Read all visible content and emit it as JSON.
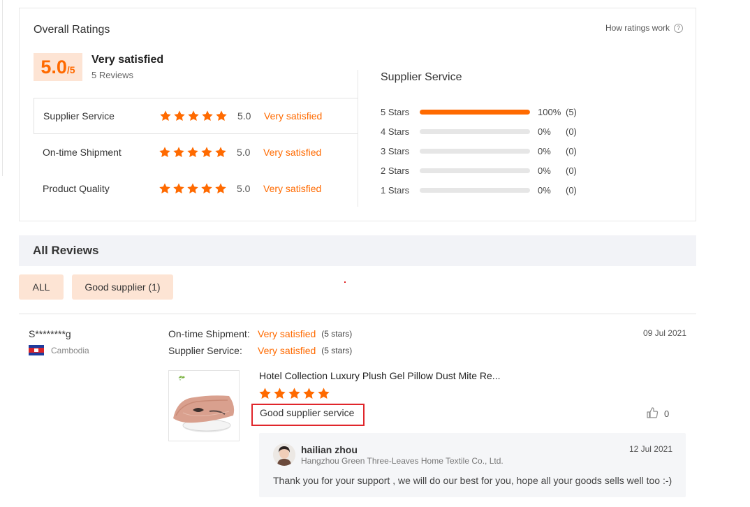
{
  "colors": {
    "accent": "#ff6a00",
    "accent_bg": "#fde4d4",
    "highlight_border": "#e0262b"
  },
  "overall": {
    "title": "Overall Ratings",
    "how_ratings_work": "How ratings work",
    "help_icon": "?",
    "score": "5.0",
    "score_max": "/5",
    "score_label": "Very satisfied",
    "reviews_count": "5 Reviews",
    "dimensions": [
      {
        "name": "Supplier Service",
        "stars": 5,
        "score": "5.0",
        "desc": "Very satisfied"
      },
      {
        "name": "On-time Shipment",
        "stars": 5,
        "score": "5.0",
        "desc": "Very satisfied"
      },
      {
        "name": "Product Quality",
        "stars": 5,
        "score": "5.0",
        "desc": "Very satisfied"
      }
    ]
  },
  "supplier_service": {
    "title": "Supplier Service",
    "distribution": [
      {
        "label": "5  Stars",
        "fraction": 1.0,
        "pct": "100%",
        "count": "(5)"
      },
      {
        "label": "4  Stars",
        "fraction": 0,
        "pct": "0%",
        "count": "(0)"
      },
      {
        "label": "3  Stars",
        "fraction": 0,
        "pct": "0%",
        "count": "(0)"
      },
      {
        "label": "2  Stars",
        "fraction": 0,
        "pct": "0%",
        "count": "(0)"
      },
      {
        "label": "1  Stars",
        "fraction": 0,
        "pct": "0%",
        "count": "(0)"
      }
    ]
  },
  "all_reviews": {
    "title": "All Reviews",
    "filters": {
      "all": "ALL",
      "good_supplier": "Good supplier (1)"
    }
  },
  "review": {
    "reviewer": "S********g",
    "country": "Cambodia",
    "flag_icon": "cambodia-flag-icon",
    "shipment_label": "On-time Shipment:",
    "shipment_value": "Very satisfied",
    "shipment_stars": "(5 stars)",
    "service_label": "Supplier Service:",
    "service_value": "Very satisfied",
    "service_stars": "(5 stars)",
    "date": "09 Jul 2021",
    "product_title": "Hotel Collection Luxury Plush Gel Pillow Dust Mite Re...",
    "product_image_icon": "pillow-product-image",
    "stars": 5,
    "text": "Good supplier service",
    "likes": "0",
    "like_icon": "thumbs-up-icon",
    "reply": {
      "name": "hailian zhou",
      "company": "Hangzhou Green Three-Leaves Home Textile Co., Ltd.",
      "date": "12 Jul 2021",
      "text": "Thank you for your support , we will do our best for you, hope all your goods sells well too :-)"
    }
  }
}
